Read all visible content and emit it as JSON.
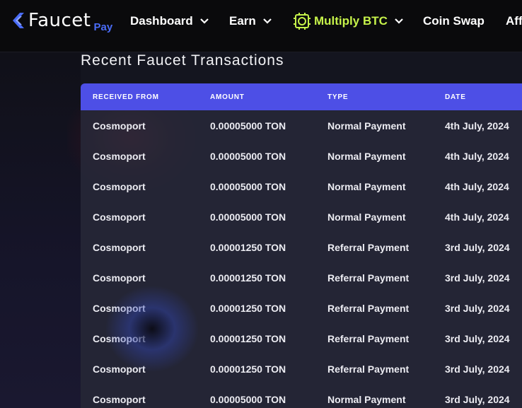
{
  "brand": {
    "name": "Faucet",
    "sub": "Pay",
    "accent": "#4a6cf7"
  },
  "nav": {
    "items": [
      {
        "label": "Dashboard",
        "dropdown": true,
        "icon": "chevron-down-icon"
      },
      {
        "label": "Earn",
        "dropdown": true,
        "icon": "chevron-down-icon"
      },
      {
        "label": "Multiply BTC",
        "dropdown": true,
        "icon": "bitcoin-chip-icon",
        "active": true,
        "color": "#c6f24a"
      },
      {
        "label": "Coin Swap",
        "dropdown": false
      },
      {
        "label": "Aff",
        "dropdown": false
      }
    ]
  },
  "section": {
    "title": "Recent Faucet Transactions"
  },
  "table": {
    "header_color": "#4d4fe6",
    "columns": [
      "RECEIVED FROM",
      "AMOUNT",
      "TYPE",
      "DATE"
    ],
    "rows": [
      [
        "Cosmoport",
        "0.00005000 TON",
        "Normal Payment",
        "4th July, 2024"
      ],
      [
        "Cosmoport",
        "0.00005000 TON",
        "Normal Payment",
        "4th July, 2024"
      ],
      [
        "Cosmoport",
        "0.00005000 TON",
        "Normal Payment",
        "4th July, 2024"
      ],
      [
        "Cosmoport",
        "0.00005000 TON",
        "Normal Payment",
        "4th July, 2024"
      ],
      [
        "Cosmoport",
        "0.00001250 TON",
        "Referral Payment",
        "3rd July, 2024"
      ],
      [
        "Cosmoport",
        "0.00001250 TON",
        "Referral Payment",
        "3rd July, 2024"
      ],
      [
        "Cosmoport",
        "0.00001250 TON",
        "Referral Payment",
        "3rd July, 2024"
      ],
      [
        "Cosmoport",
        "0.00001250 TON",
        "Referral Payment",
        "3rd July, 2024"
      ],
      [
        "Cosmoport",
        "0.00001250 TON",
        "Referral Payment",
        "3rd July, 2024"
      ],
      [
        "Cosmoport",
        "0.00005000 TON",
        "Normal Payment",
        "3rd July, 2024"
      ]
    ]
  }
}
